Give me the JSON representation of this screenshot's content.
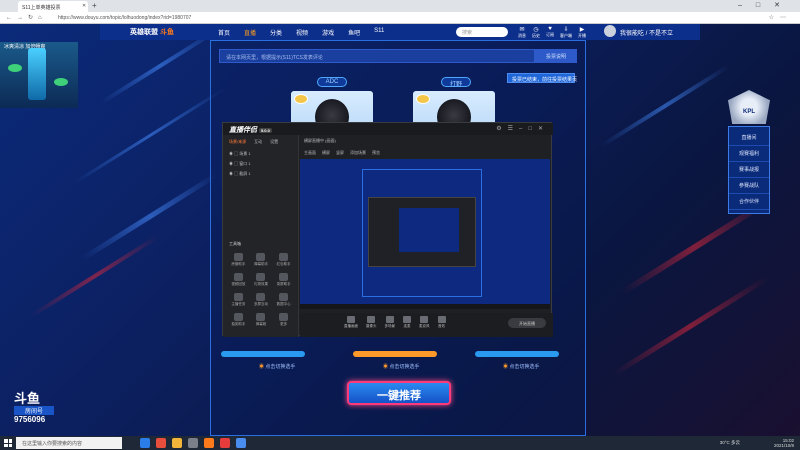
{
  "browser": {
    "tab_title": "S11上单英雄投票",
    "url": "https://www.douyu.com/topic/lolhuodong/index?rid=1980707"
  },
  "site": {
    "logo_main": "英雄联盟",
    "logo_accent": "斗鱼",
    "nav": [
      "首页",
      "直播",
      "分类",
      "视频",
      "游戏",
      "鱼吧",
      "S11"
    ],
    "search_placeholder": "搜索",
    "header_icons": [
      "消息",
      "历史",
      "订阅",
      "客户端",
      "开播"
    ],
    "username": "我很能吃 / 不是不立"
  },
  "vote": {
    "notice_placeholder": "请在本网页里，根据提示(S11)TCS发表评论",
    "notice_button": "投票说明",
    "rules_button": "投票已结束，前往投票结果页",
    "roles": [
      "ADC",
      "打野"
    ],
    "pick_label": "点击切换选手",
    "one_key_button": "一键推荐"
  },
  "kpl": {
    "emblem": "KPL",
    "menu": [
      "直播间",
      "观赛福利",
      "赛事战报",
      "参赛战队",
      "合作伙伴"
    ]
  },
  "left_overlay": {
    "ad_text": "冰爽清凉 加倍畅爽",
    "douyu_logo": "斗鱼",
    "room_label": "房间号",
    "room_number": "9756096"
  },
  "obs": {
    "app_name": "直播伴侣",
    "version": "5.0.0",
    "left_tabs": [
      "场景/来源",
      "互动",
      "设置"
    ],
    "scenes": [
      "场景 1",
      "窗口 1",
      "截屏 1"
    ],
    "tools_title": "工具箱",
    "tools": [
      "房管助手",
      "弹幕助手",
      "红包助手",
      "视频回放",
      "礼物效果",
      "录屏助手",
      "主播任务",
      "多屏互动",
      "数据中心",
      "抽奖助手",
      "弹幕姬",
      "更多"
    ],
    "preview_title": "横屏直播中 (画面)",
    "preview_tabs": [
      "主画面",
      "横屏",
      "竖屏",
      "添加场景",
      "预览"
    ],
    "toolbar": [
      "直播画面",
      "摄像头",
      "多场景",
      "连麦",
      "麦克风",
      "音效"
    ],
    "live_button": "开始直播"
  },
  "taskbar": {
    "search_placeholder": "在这里输入你要搜索的内容",
    "weather": "30°C 多云",
    "time": "15:02",
    "date": "2021/10/8"
  }
}
